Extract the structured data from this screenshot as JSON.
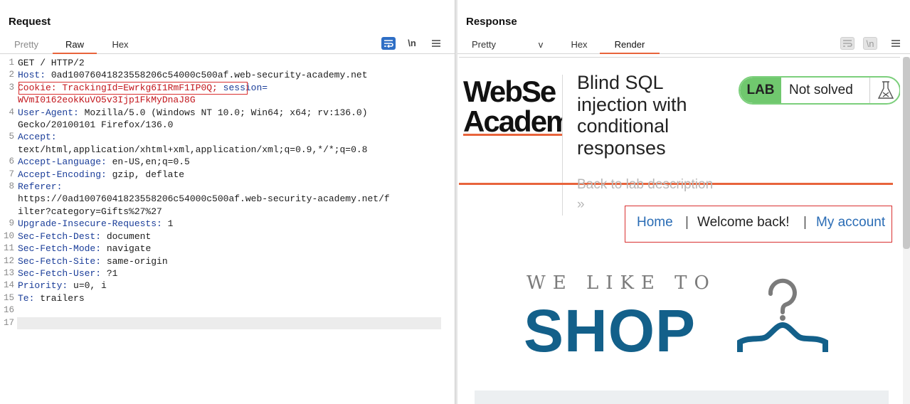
{
  "request": {
    "title": "Request",
    "tabs": [
      "Pretty",
      "Raw",
      "Hex"
    ],
    "toolbar": {
      "wrap_icon": "wrap-icon",
      "newline_label": "\\n",
      "menu_icon": "menu-icon"
    },
    "lines": {
      "n1": "1",
      "n2": "2",
      "n3": "3",
      "n4": "4",
      "n5": "5",
      "n6": "6",
      "n7": "7",
      "n8": "8",
      "n9": "9",
      "n10": "10",
      "n11": "11",
      "n12": "12",
      "n13": "13",
      "n14": "14",
      "n15": "15",
      "n16": "16",
      "n17": "17",
      "l1": "GET / HTTP/2",
      "l2_name": "Host:",
      "l2_val": " 0ad10076041823558206c54000c500af.web-security-academy.net",
      "l3_name": "Cookie:",
      "l3_key": " TrackingId=",
      "l3_val": "Ewrkg6I1RmF1IP0Q;",
      "l3_session": " session=",
      "l3_cont": "WVmI0162eokKuVO5v3Ijp1FkMyDnaJ8G",
      "l4_name": "User-Agent:",
      "l4_val": " Mozilla/5.0 (Windows NT 10.0; Win64; x64; rv:136.0)",
      "l4_cont": "Gecko/20100101 Firefox/136.0",
      "l5_name": "Accept:",
      "l5_cont": "text/html,application/xhtml+xml,application/xml;q=0.9,*/*;q=0.8",
      "l6_name": "Accept-Language:",
      "l6_val": " en-US,en;q=0.5",
      "l7_name": "Accept-Encoding:",
      "l7_val": " gzip, deflate",
      "l8_name": "Referer:",
      "l8_cont1": "https://0ad10076041823558206c54000c500af.web-security-academy.net/f",
      "l8_cont2": "ilter?category=Gifts%27%27",
      "l9_name": "Upgrade-Insecure-Requests:",
      "l9_val": " 1",
      "l10_name": "Sec-Fetch-Dest:",
      "l10_val": " document",
      "l11_name": "Sec-Fetch-Mode:",
      "l11_val": " navigate",
      "l12_name": "Sec-Fetch-Site:",
      "l12_val": " same-origin",
      "l13_name": "Sec-Fetch-User:",
      "l13_val": " ?1",
      "l14_name": "Priority:",
      "l14_val": " u=0, i",
      "l15_name": "Te:",
      "l15_val": " trailers"
    }
  },
  "response": {
    "title": "Response",
    "tabs": [
      "Pretty",
      "v",
      "Hex",
      "Render"
    ],
    "toolbar": {
      "newline_label": "\\n"
    },
    "render": {
      "logo_line1": "WebSe",
      "logo_line2": "Academ",
      "lab_title": "Blind SQL injection with conditional responses",
      "back_link": "Back to lab description",
      "back_arrows": "»",
      "lab_badge": "LAB",
      "lab_status": "Not solved",
      "nav_home": "Home",
      "nav_sep": "|",
      "nav_welcome": "Welcome back!",
      "nav_account": "My account",
      "tagline": "WE LIKE TO",
      "shop": "SHOP"
    }
  },
  "colors": {
    "accent_orange": "#e8643c",
    "highlight_red": "#d93030",
    "header_blue": "#1a3d99",
    "shop_blue": "#13608a",
    "lab_green": "#70c86e"
  }
}
